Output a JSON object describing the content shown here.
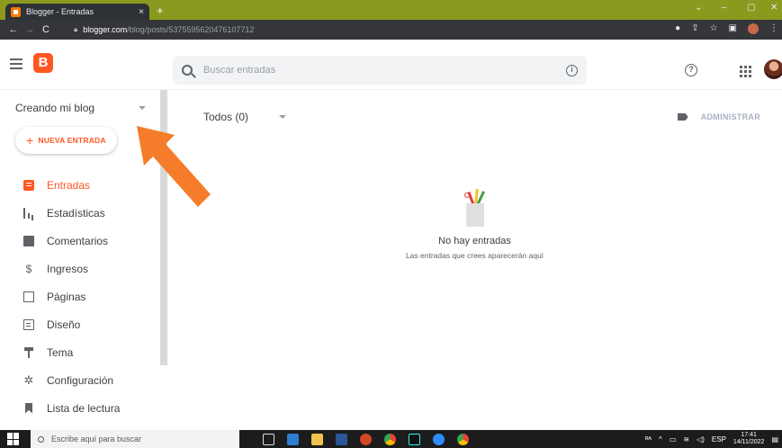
{
  "browser": {
    "tab_title": "Blogger - Entradas",
    "tab_close": "×",
    "new_tab": "+",
    "url_host": "blogger.com",
    "url_path": "/blog/posts/5375595620476107712",
    "window_controls": [
      "⌄",
      "–",
      "▢",
      "✕"
    ]
  },
  "header": {
    "logo_letter": "B",
    "search_placeholder": "Buscar entradas",
    "info_glyph": "i",
    "help_glyph": "?"
  },
  "sidebar": {
    "blog_name": "Creando mi blog",
    "new_post_label": "NUEVA ENTRADA",
    "items": [
      {
        "label": "Entradas",
        "icon": "posts-icon",
        "active": true
      },
      {
        "label": "Estadísticas",
        "icon": "stats-icon"
      },
      {
        "label": "Comentarios",
        "icon": "comments-icon"
      },
      {
        "label": "Ingresos",
        "icon": "earnings-icon"
      },
      {
        "label": "Páginas",
        "icon": "pages-icon"
      },
      {
        "label": "Diseño",
        "icon": "layout-icon"
      },
      {
        "label": "Tema",
        "icon": "theme-icon"
      },
      {
        "label": "Configuración",
        "icon": "settings-icon"
      },
      {
        "label": "Lista de lectura",
        "icon": "reading-list-icon"
      }
    ]
  },
  "main": {
    "filter_label": "Todos (0)",
    "manage_label": "ADMINISTRAR",
    "empty_title": "No hay entradas",
    "empty_subtitle": "Las entradas que crees aparecerán aquí"
  },
  "taskbar": {
    "search_placeholder": "Escribe aquí para buscar",
    "language": "ESP",
    "time": "17:41",
    "date": "14/11/2022"
  },
  "colors": {
    "accent": "#ff5722",
    "annotation_arrow": "#f57c2a",
    "tab_strip": "#8b9a1f"
  }
}
